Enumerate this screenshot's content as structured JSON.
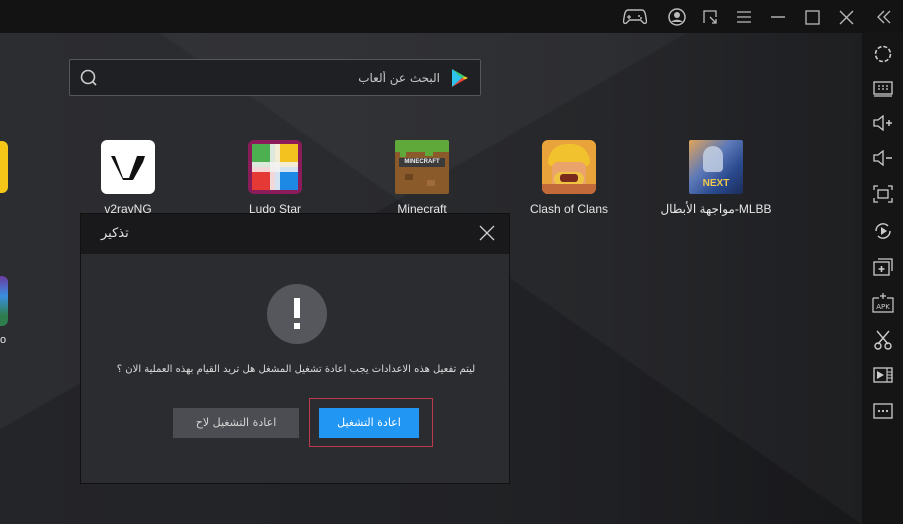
{
  "titlebar": {
    "icons": [
      {
        "name": "gamepad-icon"
      },
      {
        "name": "account-icon"
      },
      {
        "name": "resize-icon"
      },
      {
        "name": "menu-icon"
      },
      {
        "name": "minimize-icon"
      },
      {
        "name": "maximize-icon"
      },
      {
        "name": "close-icon"
      },
      {
        "name": "collapse-sidebar-icon"
      }
    ]
  },
  "search": {
    "placeholder": "البحث عن ألعاب"
  },
  "apps": [
    {
      "label": "v2rayNG",
      "icon": "v2rayng-icon"
    },
    {
      "label": "Ludo Star",
      "icon": "ludo-star-icon"
    },
    {
      "label": "Minecraft",
      "icon": "minecraft-icon"
    },
    {
      "label": "Clash of Clans",
      "icon": "clash-of-clans-icon"
    },
    {
      "label": "مواجهة الأبطال-MLBB",
      "icon": "mlbb-icon"
    }
  ],
  "partial_app_label": "o",
  "sidebar": {
    "icons": [
      "settings-icon",
      "keyboard-icon",
      "volume-up-icon",
      "volume-down-icon",
      "fullscreen-icon",
      "rotate-icon",
      "multi-instance-icon",
      "install-apk-icon",
      "screenshot-icon",
      "record-video-icon",
      "more-icon"
    ]
  },
  "dialog": {
    "title": "تذكير",
    "message": "ليتم تفعيل هذه الاعدادات يجب اعادة تشغيل المشغل  هل تريد القيام بهذه العملية الان ؟",
    "restart_label": "اعادة التشغيل",
    "restart_later_label": "اعادة التشغيل لاح"
  }
}
